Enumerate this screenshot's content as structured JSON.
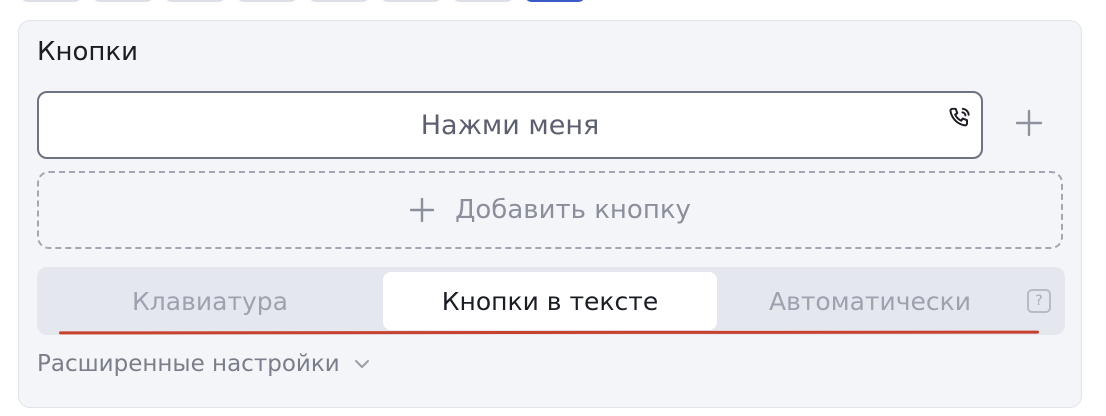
{
  "top_tabs": {
    "count": 8,
    "active_index": 7
  },
  "card": {
    "title": "Кнопки",
    "button_field": {
      "label": "Нажми меня",
      "icon": "phone-icon"
    },
    "add_button": {
      "label": "Добавить кнопку",
      "icon": "plus-icon"
    },
    "segmented": {
      "items": [
        {
          "label": "Клавиатура",
          "active": false
        },
        {
          "label": "Кнопки в тексте",
          "active": true
        },
        {
          "label": "Автоматически",
          "active": false
        }
      ],
      "help_icon": "?"
    },
    "advanced_label": "Расширенные настройки"
  },
  "colors": {
    "accent": "#3a5bc7",
    "annotation_line": "#c8402e",
    "card_bg": "#f4f5f8",
    "segment_bg": "#e4e7ee"
  }
}
